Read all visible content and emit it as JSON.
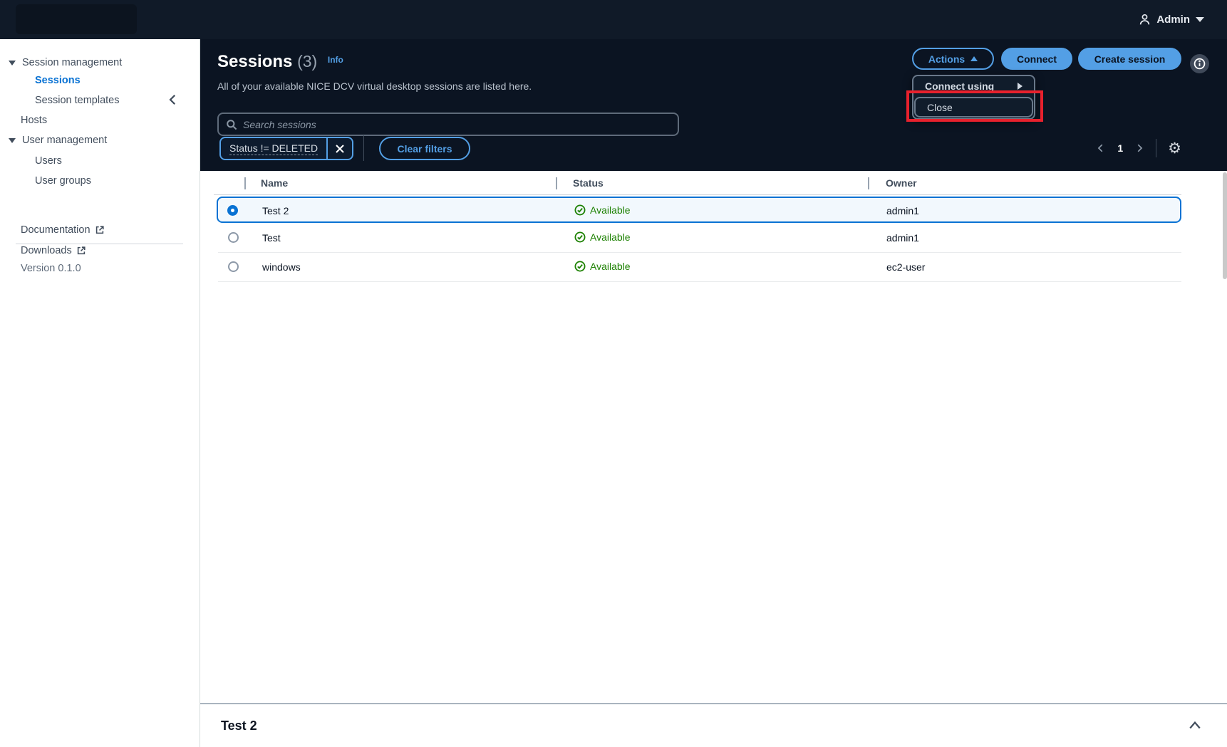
{
  "topbar": {
    "user": "Admin"
  },
  "sidebar": {
    "session_management": "Session management",
    "sessions": "Sessions",
    "session_templates": "Session templates",
    "hosts": "Hosts",
    "user_management": "User management",
    "users": "Users",
    "user_groups": "User groups",
    "documentation": "Documentation",
    "downloads": "Downloads",
    "version": "Version 0.1.0"
  },
  "header": {
    "title": "Sessions",
    "count": "(3)",
    "info_label": "Info",
    "subtitle": "All of your available NICE DCV virtual desktop sessions are listed here."
  },
  "search": {
    "placeholder": "Search sessions"
  },
  "filters": {
    "token": "Status != DELETED",
    "clear_label": "Clear filters"
  },
  "toolbar": {
    "actions_label": "Actions",
    "connect_label": "Connect",
    "create_label": "Create session"
  },
  "actions_menu": {
    "connect_using": "Connect using",
    "close": "Close"
  },
  "pagination": {
    "current_page": "1"
  },
  "table": {
    "columns": [
      "Name",
      "Status",
      "Owner"
    ],
    "rows": [
      {
        "name": "Test 2",
        "status": "Available",
        "owner": "admin1",
        "selected": true
      },
      {
        "name": "Test",
        "status": "Available",
        "owner": "admin1",
        "selected": false
      },
      {
        "name": "windows",
        "status": "Available",
        "owner": "ec2-user",
        "selected": false
      }
    ]
  },
  "split_panel": {
    "title": "Test 2"
  },
  "colors": {
    "dark_accent_blue": "#539fe5",
    "light_accent_blue": "#0972d3",
    "success_green": "#1d8102",
    "annotation_red": "#e8212d",
    "band_background": "#0b1422",
    "topbar_background": "#101a28"
  }
}
